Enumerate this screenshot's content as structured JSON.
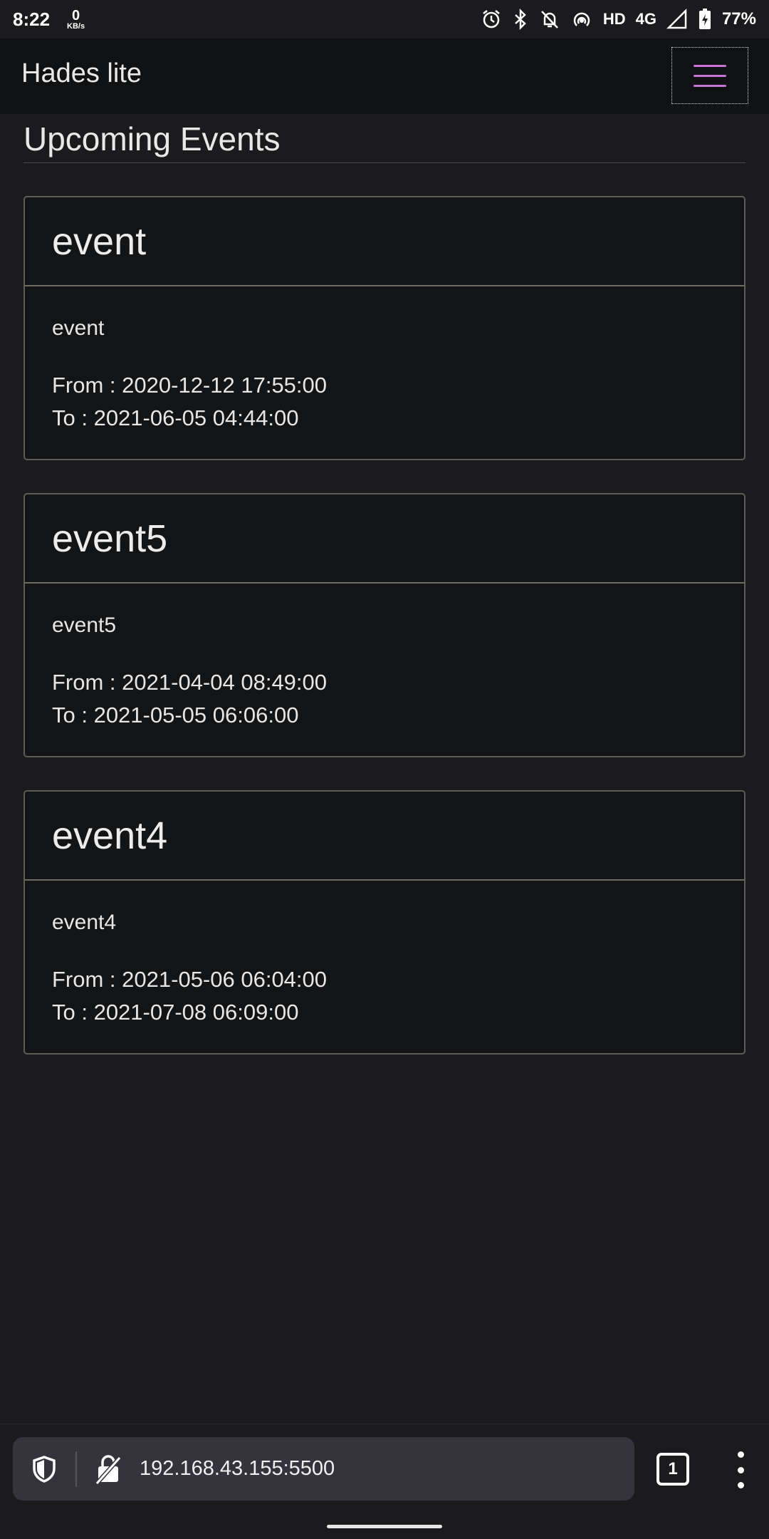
{
  "status_bar": {
    "time": "8:22",
    "net_speed_value": "0",
    "net_speed_unit": "KB/s",
    "network_label": "HD",
    "network_type": "4G",
    "battery": "77%",
    "icons": [
      "alarm-icon",
      "bluetooth-icon",
      "muted-bell-icon",
      "hotspot-icon",
      "signal-icon",
      "battery-charging-icon"
    ]
  },
  "navbar": {
    "brand": "Hades lite",
    "menu_icon": "hamburger-icon",
    "menu_color": "#c874d6"
  },
  "page": {
    "title": "Upcoming Events"
  },
  "events": [
    {
      "title": "event",
      "description": "event",
      "from": "From : 2020-12-12 17:55:00",
      "to": "To : 2021-06-05 04:44:00"
    },
    {
      "title": "event5",
      "description": "event5",
      "from": "From : 2021-04-04 08:49:00",
      "to": "To : 2021-05-05 06:06:00"
    },
    {
      "title": "event4",
      "description": "event4",
      "from": "From : 2021-05-06 06:04:00",
      "to": "To : 2021-07-08 06:09:00"
    }
  ],
  "browser": {
    "url": "192.168.43.155:5500",
    "tab_count": "1",
    "icons": [
      "shield-icon",
      "insecure-lock-icon",
      "tabs-icon",
      "more-vert-icon"
    ]
  }
}
